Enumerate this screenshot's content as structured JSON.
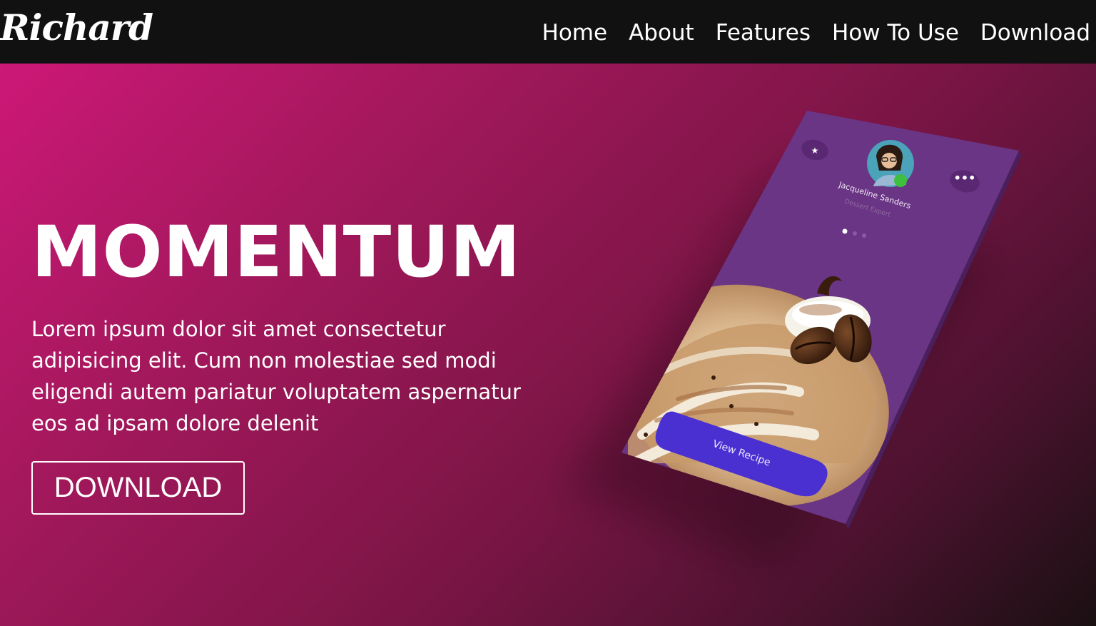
{
  "nav": {
    "logo": "Richard",
    "links": [
      "Home",
      "About",
      "Features",
      "How To Use",
      "Download"
    ]
  },
  "hero": {
    "title": "MOMENTUM",
    "text": "Lorem ipsum dolor sit amet consectetur adipisicing elit. Cum non molestiae sed modi eligendi autem pariatur voluptatem aspernatur eos ad ipsam dolore delenit",
    "button_label": "DOWNLOAD"
  },
  "phone": {
    "user_name": "Jacqueline Sanders",
    "user_role": "Dessert Expert",
    "cta_label": "View Recipe",
    "star_icon": "star-icon",
    "more_icon": "more-dots-icon"
  },
  "colors": {
    "navbar": "#111111",
    "gradient_start": "#cc1877",
    "gradient_end": "#1a1012",
    "phone_screen": "#6a3584",
    "cta_button": "#4a30d0",
    "status_online": "#3fbf3f"
  }
}
